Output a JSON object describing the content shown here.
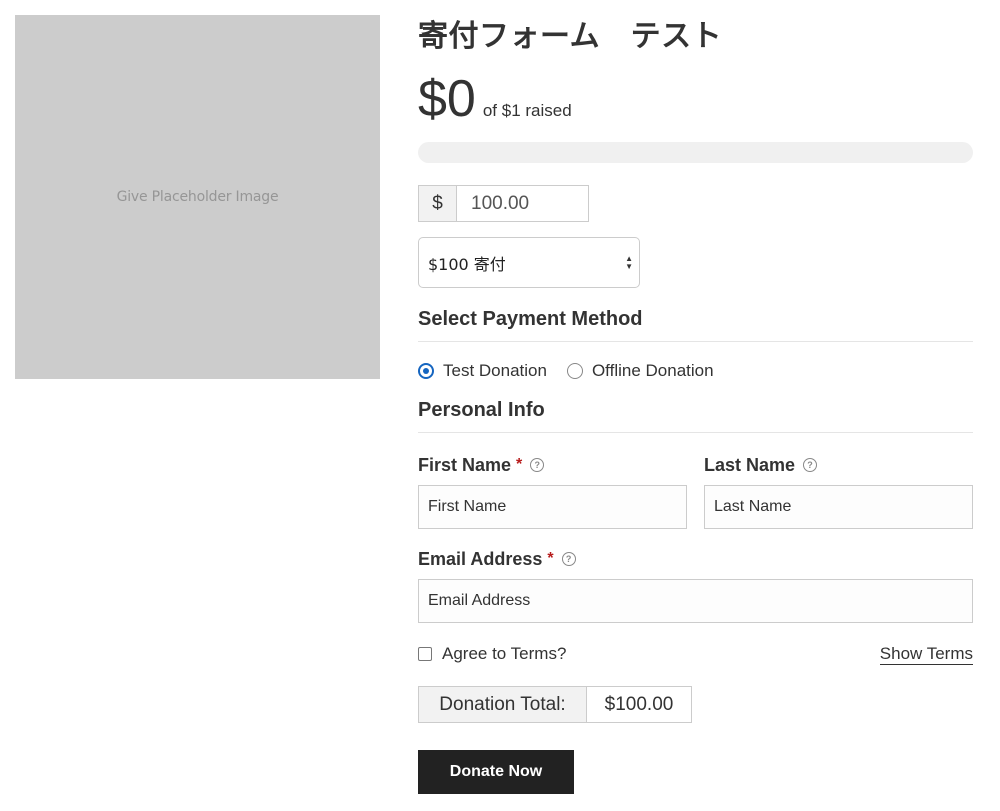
{
  "image": {
    "placeholder_text": "Give Placeholder Image"
  },
  "form": {
    "title": "寄付フォーム　テスト",
    "goal": {
      "raised_amount": "$0",
      "raised_text": "of $1 raised",
      "progress_fraction": 0,
      "progress_color": "#66bb6a"
    },
    "amount": {
      "currency_symbol": "$",
      "value": "100.00"
    },
    "level_select": {
      "selected": "$100 寄付",
      "arrows_up": "▲",
      "arrows_down": "▼"
    },
    "payment": {
      "title": "Select Payment Method",
      "options": [
        {
          "label": "Test Donation",
          "checked": true
        },
        {
          "label": "Offline Donation",
          "checked": false
        }
      ],
      "accent_color": "#1565c0"
    },
    "personal_info": {
      "title": "Personal Info",
      "first_name": {
        "label": "First Name",
        "required_mark": "*",
        "help": "?",
        "placeholder": "First Name"
      },
      "last_name": {
        "label": "Last Name",
        "help": "?",
        "placeholder": "Last Name"
      },
      "email": {
        "label": "Email Address",
        "required_mark": "*",
        "help": "?",
        "placeholder": "Email Address"
      }
    },
    "terms": {
      "label": "Agree to Terms?",
      "show_link": "Show Terms"
    },
    "total": {
      "label": "Donation Total:",
      "value": "$100.00"
    },
    "submit": {
      "label": "Donate Now",
      "color": "#222222"
    }
  }
}
